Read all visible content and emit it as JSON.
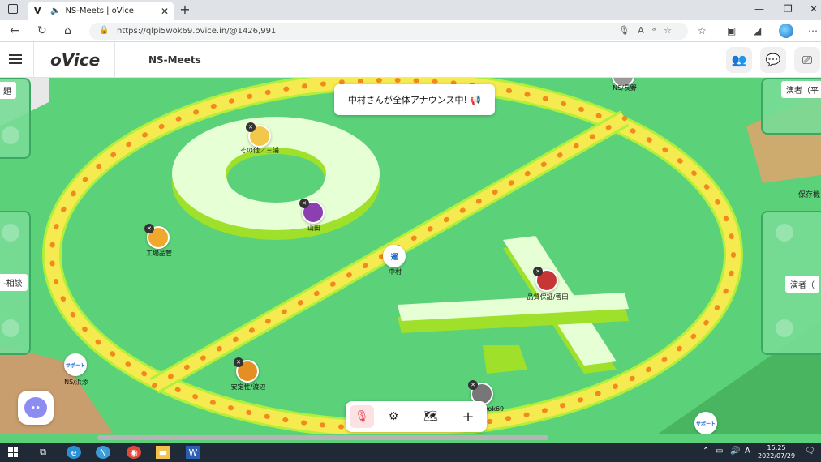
{
  "browser": {
    "tab_title": "NS-Meets | oVice",
    "tab_favicon": "V",
    "new_tab": "+",
    "url": "https://qlpi5wok69.ovice.in/@1426,991",
    "window_controls": [
      "—",
      "❐",
      "✕"
    ]
  },
  "app": {
    "logo": "oVice",
    "space_name": "NS-Meets"
  },
  "announcement": "中村さんが全体アナウンス中! 📢",
  "side_labels": {
    "left_top": "題",
    "left_mid": "-相談",
    "right_top": "演者（平",
    "right_mid": "演者（",
    "right_storage": "保存機"
  },
  "users": [
    {
      "name": "その他／三浦",
      "badge": ""
    },
    {
      "name": "山田",
      "badge": ""
    },
    {
      "name": "工場品管",
      "badge": ""
    },
    {
      "name": "中村",
      "badge": "運"
    },
    {
      "name": "品質保証/菅田",
      "badge": ""
    },
    {
      "name": "NS/浜添",
      "badge": "サポート"
    },
    {
      "name": "安定性/渡辺",
      "badge": ""
    },
    {
      "name": "wok69",
      "badge": ""
    },
    {
      "name": "NS/長野",
      "badge": ""
    },
    {
      "name": "",
      "badge": "サポート"
    }
  ],
  "toolbar": {
    "mic": "mic-off",
    "settings": "settings",
    "map": "map",
    "add": "+"
  },
  "taskbar": {
    "time": "15:25",
    "date": "2022/07/29",
    "ime": "A"
  },
  "colors": {
    "floor": "#5bd17a",
    "track": "#f5ea4f",
    "track_dot": "#f08a1c",
    "mic_muted": "#e34a5a"
  }
}
